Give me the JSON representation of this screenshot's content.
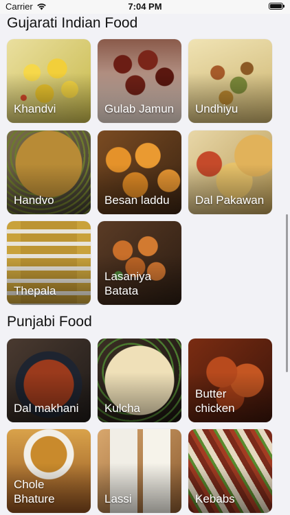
{
  "status_bar": {
    "carrier": "Carrier",
    "time": "7:04 PM",
    "wifi_icon": "wifi-icon",
    "battery_icon": "battery-full-icon",
    "battery_level": 1.0
  },
  "sections": [
    {
      "title": "Gujarati Indian Food",
      "items": [
        {
          "label": "Khandvi",
          "image": "khandvi-photo"
        },
        {
          "label": "Gulab Jamun",
          "image": "gulab-jamun-photo"
        },
        {
          "label": "Undhiyu",
          "image": "undhiyu-photo"
        },
        {
          "label": "Handvo",
          "image": "handvo-photo"
        },
        {
          "label": "Besan laddu",
          "image": "besan-laddu-photo"
        },
        {
          "label": "Dal Pakawan",
          "image": "dal-pakawan-photo"
        },
        {
          "label": "Thepala",
          "image": "thepala-photo"
        },
        {
          "label": "Lasaniya Batata",
          "image": "lasaniya-batata-photo"
        }
      ]
    },
    {
      "title": "Punjabi Food",
      "items": [
        {
          "label": "Dal makhani",
          "image": "dal-makhani-photo"
        },
        {
          "label": "Kulcha",
          "image": "kulcha-photo"
        },
        {
          "label": "Butter chicken",
          "image": "butter-chicken-photo"
        },
        {
          "label": "Chole Bhature",
          "image": "chole-bhature-photo"
        },
        {
          "label": "Lassi",
          "image": "lassi-photo"
        },
        {
          "label": "Kebabs",
          "image": "kebabs-photo"
        }
      ]
    }
  ]
}
